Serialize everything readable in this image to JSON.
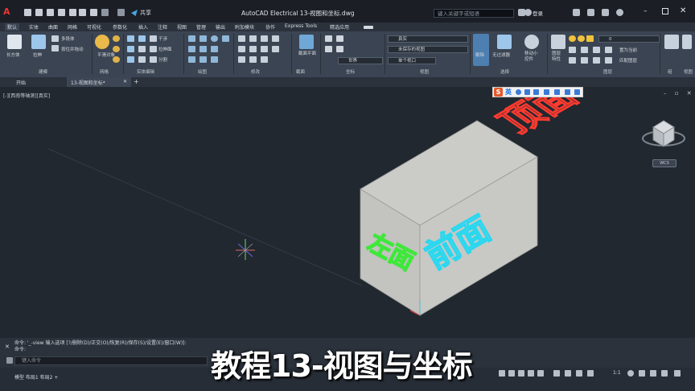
{
  "titlebar": {
    "logo": "A",
    "share_label": "共享",
    "title": "AutoCAD Electrical    13-视图和坐标.dwg",
    "search_placeholder": "键入关键字或短语",
    "login_label": "登录"
  },
  "ribbon_tabs": [
    "默认",
    "实体",
    "曲面",
    "网格",
    "可视化",
    "参数化",
    "插入",
    "注释",
    "视图",
    "管理",
    "输出",
    "附加模块",
    "协作",
    "Express Tools",
    "精选应用"
  ],
  "ribbon": {
    "modeling": {
      "box_label": "长方体",
      "extrude_label": "拉伸",
      "polysolid_label": "多段体",
      "presspull_label": "按住并拖动",
      "panel_label": "建模"
    },
    "mesh": {
      "smooth_label": "平滑对象",
      "panel_label": "网格"
    },
    "solid_edit": {
      "interfere_label": "干涉",
      "extract_label": "拉伸面",
      "separate_label": "分割",
      "panel_label": "实体编辑"
    },
    "draw": {
      "panel_label": "绘图"
    },
    "modify": {
      "panel_label": "修改"
    },
    "section": {
      "plane_label": "截面平面",
      "panel_label": "截面"
    },
    "coords": {
      "world_label": "世界",
      "panel_label": "坐标"
    },
    "view": {
      "visual_style": "真实",
      "unsaved_view": "未保存的视图",
      "single_viewport": "单个视口",
      "panel_label": "视图"
    },
    "selection": {
      "culling_label": "剔除",
      "no_filter_label": "无过滤器",
      "gizmo_label": "移动小控件",
      "panel_label": "选择"
    },
    "layers": {
      "layer_value": "0",
      "properties_label": "图层特性",
      "set_current_label": "置为当前",
      "match_label": "匹配图层",
      "panel_label": "图层"
    },
    "groups": {
      "panel_label": "组"
    },
    "view_extra": {
      "panel_label": "视图"
    }
  },
  "file_tabs": {
    "start": "开始",
    "active": "13-视图和坐标*",
    "add": "+"
  },
  "viewport": {
    "label": "[-][西南等轴测][真实]",
    "controls": "– ▫ ✕",
    "viewcube_label": "WCS",
    "faces": {
      "top": "顶面",
      "front": "前面",
      "left": "左面"
    }
  },
  "ime": {
    "logo": "S",
    "lang": "英"
  },
  "command": {
    "history_1": "命令:  '_-view  输入选项 [?/删除(D)/正交(O)/恢复(R)/保存(S)/设置(E)/窗口(W)]:",
    "history_2": "命令:",
    "prompt": "键入命令"
  },
  "statusbar": {
    "layouts": "模型   布局1   布局2   +",
    "scale": "1:1"
  },
  "caption": "教程13-视图与坐标",
  "colors": {
    "top_text": "#ff3b2f",
    "front_text": "#27d8f0",
    "left_text": "#3ee83a",
    "box_face": "#c6c6c3"
  }
}
